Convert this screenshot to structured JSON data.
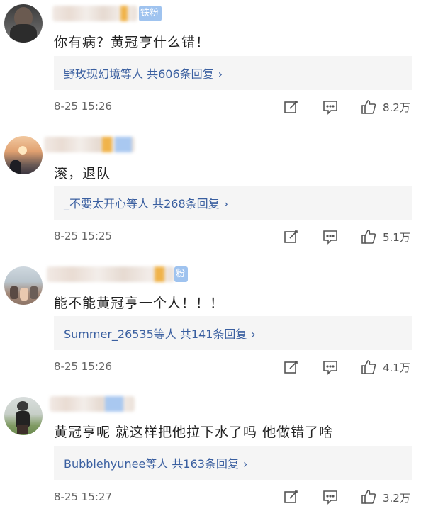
{
  "colors": {
    "reply_link": "#3a5fa0",
    "badge_bg": "#9fc3ef"
  },
  "comments": [
    {
      "badge": "铁粉",
      "text": "你有病？黄冠亨什么错！",
      "reply_summary": "野玫瑰幻境等人 共606条回复",
      "time": "8-25 15:26",
      "likes": "8.2万",
      "icons": [
        "edit-icon",
        "comment-icon",
        "like-icon"
      ]
    },
    {
      "badge": "",
      "text": "滚，退队",
      "reply_summary": "_不要太开心等人 共268条回复",
      "time": "8-25 15:25",
      "likes": "5.1万",
      "icons": [
        "edit-icon",
        "comment-icon",
        "like-icon"
      ]
    },
    {
      "badge": "粉",
      "text": "能不能黄冠亨一个人！！！",
      "reply_summary": "Summer_26535等人 共141条回复",
      "time": "8-25 15:26",
      "likes": "4.1万",
      "icons": [
        "edit-icon",
        "comment-icon",
        "like-icon"
      ]
    },
    {
      "badge": "",
      "text": "黄冠亨呢 就这样把他拉下水了吗 他做错了啥",
      "reply_summary": "Bubblehyunee等人 共163条回复",
      "time": "8-25 15:27",
      "likes": "3.2万",
      "icons": [
        "edit-icon",
        "comment-icon",
        "like-icon"
      ]
    }
  ]
}
